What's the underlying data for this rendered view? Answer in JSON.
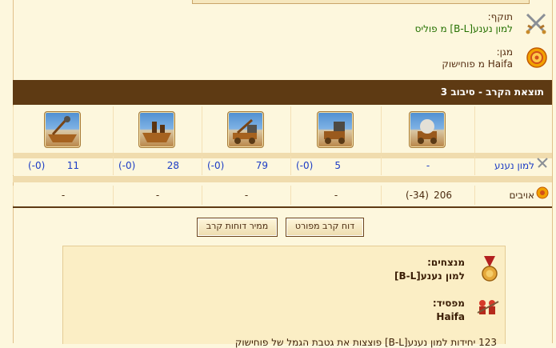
{
  "attacker": {
    "label": "תוקף:",
    "name": "למון נענע[B-L] מ פוליס",
    "icon": "crossed-swords-icon"
  },
  "defender": {
    "label": "מגן:",
    "name": "Haifa מ פוחישוק",
    "icon": "orange-shield-icon"
  },
  "battle_header": "תוצאת הקרב - סיבוב 3",
  "units": [
    "ram",
    "catapult",
    "mortar",
    "steam-giant",
    "cannon-ship"
  ],
  "attacker_row": {
    "name": "למון נענע",
    "cells": [
      {
        "count": "-",
        "loss": ""
      },
      {
        "count": "5",
        "loss": "(0-)"
      },
      {
        "count": "79",
        "loss": "(0-)"
      },
      {
        "count": "28",
        "loss": "(0-)"
      },
      {
        "count": "11",
        "loss": "(0-)"
      }
    ]
  },
  "defender_row": {
    "name": "אויבים",
    "cells": [
      {
        "count": "206",
        "loss": "(34-)"
      },
      {
        "count": "-",
        "loss": ""
      },
      {
        "count": "-",
        "loss": ""
      },
      {
        "count": "-",
        "loss": ""
      },
      {
        "count": "-",
        "loss": ""
      }
    ]
  },
  "buttons": {
    "detailed": "דוח קרב מפורט",
    "reports": "ממיר דוחות קרב"
  },
  "result": {
    "winners_label": "מנצחים:",
    "winners_name": "למון נענע[B-L]",
    "loser_label": "מפסיד:",
    "loser_name": "Haifa",
    "summary_cut": "123 יחידות למון נענע[B-L] פוצצות את גטבת הגמל של פוחישוק"
  },
  "colors": {
    "header_bg": "#5e3a13",
    "link_blue": "#1c3cc5",
    "green": "#247000",
    "page_bg": "#fdf7dd"
  }
}
